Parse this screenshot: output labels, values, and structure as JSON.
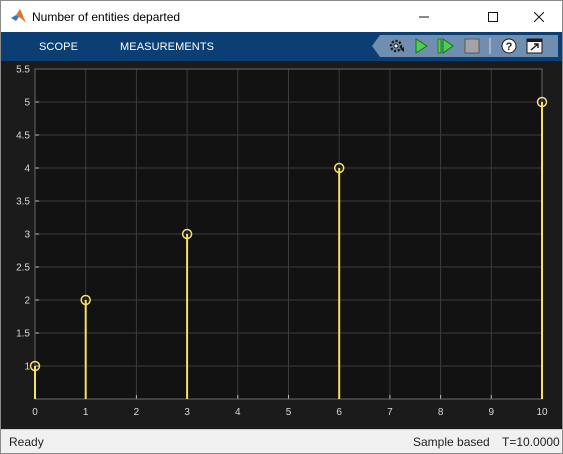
{
  "window": {
    "title": "Number of entities departed",
    "icon": "matlab-logo-icon",
    "controls": [
      "minimize-icon",
      "maximize-icon",
      "close-icon"
    ]
  },
  "toolstrip": {
    "tabs": [
      {
        "label": "SCOPE"
      },
      {
        "label": "MEASUREMENTS"
      }
    ],
    "buttons": [
      "settings-gear-icon",
      "run-icon",
      "step-forward-icon",
      "stop-icon",
      "help-icon",
      "undock-icon"
    ],
    "colors": {
      "background": "#0b3f73",
      "run": "#4ad24a",
      "stop": "#a0a0a0"
    }
  },
  "status": {
    "left": "Ready",
    "mode": "Sample based",
    "time": "T=10.0000"
  },
  "chart_data": {
    "type": "stem",
    "x": [
      0,
      1,
      3,
      6,
      10
    ],
    "y": [
      1,
      2,
      3,
      4,
      5
    ],
    "xlim": [
      0,
      10
    ],
    "ylim": [
      0.5,
      5.5
    ],
    "xticks": [
      "0",
      "1",
      "2",
      "3",
      "4",
      "5",
      "6",
      "7",
      "8",
      "9",
      "10"
    ],
    "yticks": [
      "1",
      "1.5",
      "2",
      "2.5",
      "3",
      "3.5",
      "4",
      "4.5",
      "5",
      "5.5"
    ],
    "grid": true,
    "marker": "circle",
    "color": "#f5e06a",
    "background": "#121212"
  }
}
